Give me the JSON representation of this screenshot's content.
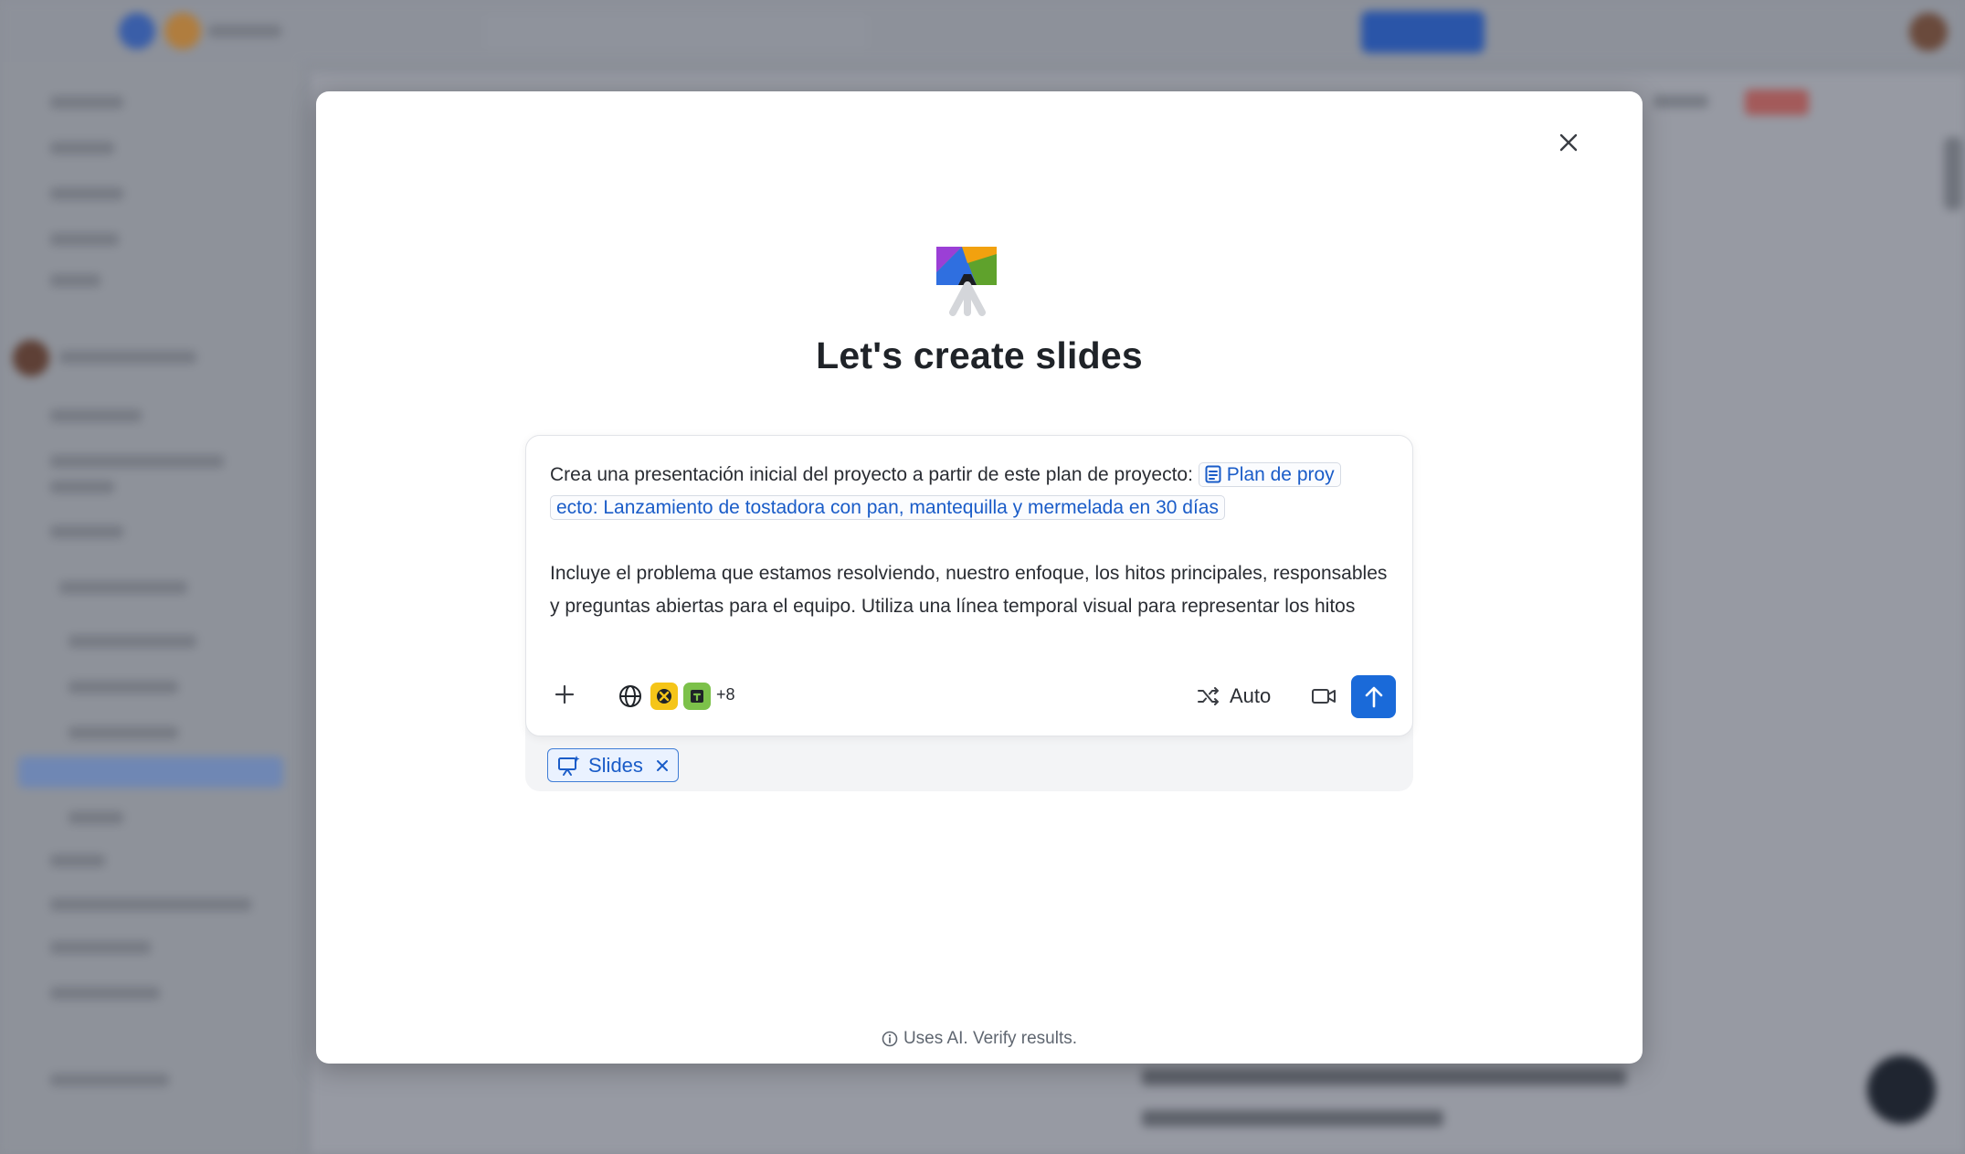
{
  "modal": {
    "title": "Let's create slides",
    "close_icon": "close-icon"
  },
  "composer": {
    "prompt_intro": "Crea una presentación inicial del proyecto a partir de este plan de proyecto:",
    "mention_line1": "Plan de proy",
    "mention_line2": "ecto: Lanzamiento de tostadora con pan, mantequilla y mermelada en 30 días",
    "prompt_body": "Incluye el problema que estamos resolviendo, nuestro enfoque, los hitos principales, responsables y preguntas abiertas para el equipo. Utiliza una línea temporal visual para representar los hitos",
    "sources_more": "+8",
    "model_label": "Auto",
    "icons": {
      "add": "plus-icon",
      "globe": "globe-icon",
      "shuffle": "shuffle-icon",
      "video": "video-icon",
      "send": "arrow-up-icon",
      "mention": "document-icon"
    }
  },
  "chip": {
    "label": "Slides"
  },
  "footer": {
    "note": "Uses AI. Verify results."
  },
  "colors": {
    "accent": "#1a6ad9",
    "mention_text": "#1a5cc8",
    "chip_bg": "#eaf2ff",
    "overlay": "#8b8f98"
  }
}
